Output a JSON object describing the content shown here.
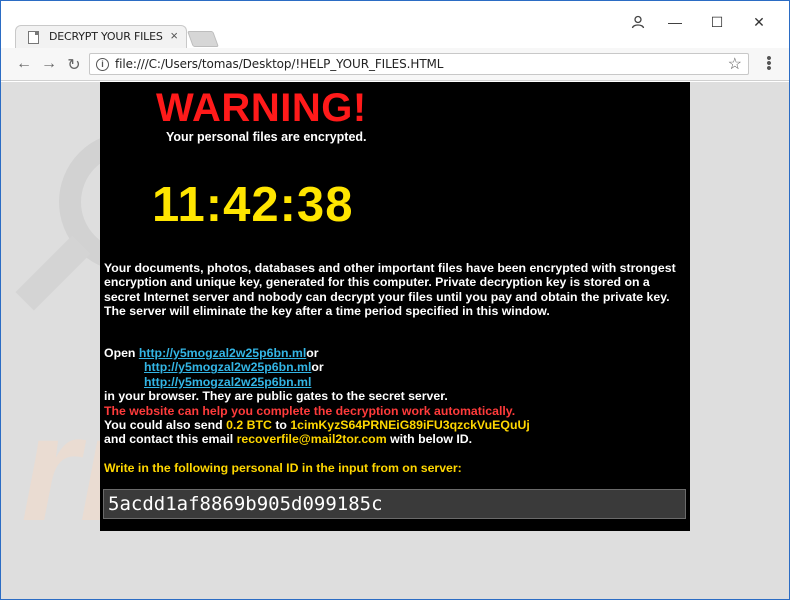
{
  "browser": {
    "tab_title": "DECRYPT YOUR FILES",
    "tab_close": "×",
    "url": "file:///C:/Users/tomas/Desktop/!HELP_YOUR_FILES.HTML",
    "controls": {
      "minimize": "—",
      "maximize": "☐",
      "close": "✕"
    }
  },
  "note": {
    "title": "WARNING!",
    "subtitle": "Your personal files are encrypted.",
    "timer": "11:42:38",
    "paragraph": "Your documents, photos, databases and other important files have been encrypted with strongest encryption and unique key, generated for this computer. Private decryption key is stored on a secret Internet server and nobody can decrypt your files until you pay and obtain the private key. The server will eliminate the key after a time period specified in this window.",
    "open_prefix": "Open",
    "links": [
      "http://y5mogzal2w25p6bn.ml",
      "http://y5mogzal2w25p6bn.ml",
      "http://y5mogzal2w25p6bn.ml"
    ],
    "link_suffix": "or",
    "browser_line": "in your browser. They are public gates to the secret server.",
    "help_line": "The website can help you complete the decryption work automatically.",
    "send_prefix": "You could also send",
    "amount": "0.2 BTC",
    "send_to": "to",
    "btc_address": "1cimKyzS64PRNEiG89iFU3qzckVuEQuUj",
    "contact_prefix": "and contact this email",
    "email": "recoverfile@mail2tor.com",
    "contact_suffix": "with below ID.",
    "id_prompt": "Write in the following personal ID in the input from on server:",
    "personal_id": "5acdd1af8869b905d099185c"
  },
  "colors": {
    "warning": "#ff1a1a",
    "timer": "#ffe500",
    "link": "#33b5e5",
    "accent_yellow": "#ffd700",
    "alert_red": "#ff3b3b"
  },
  "icons": [
    "page-icon",
    "back-arrow-icon",
    "forward-arrow-icon",
    "reload-icon",
    "info-icon",
    "star-icon",
    "menu-dots-icon",
    "profile-icon",
    "minimize-icon",
    "maximize-icon",
    "close-icon"
  ]
}
